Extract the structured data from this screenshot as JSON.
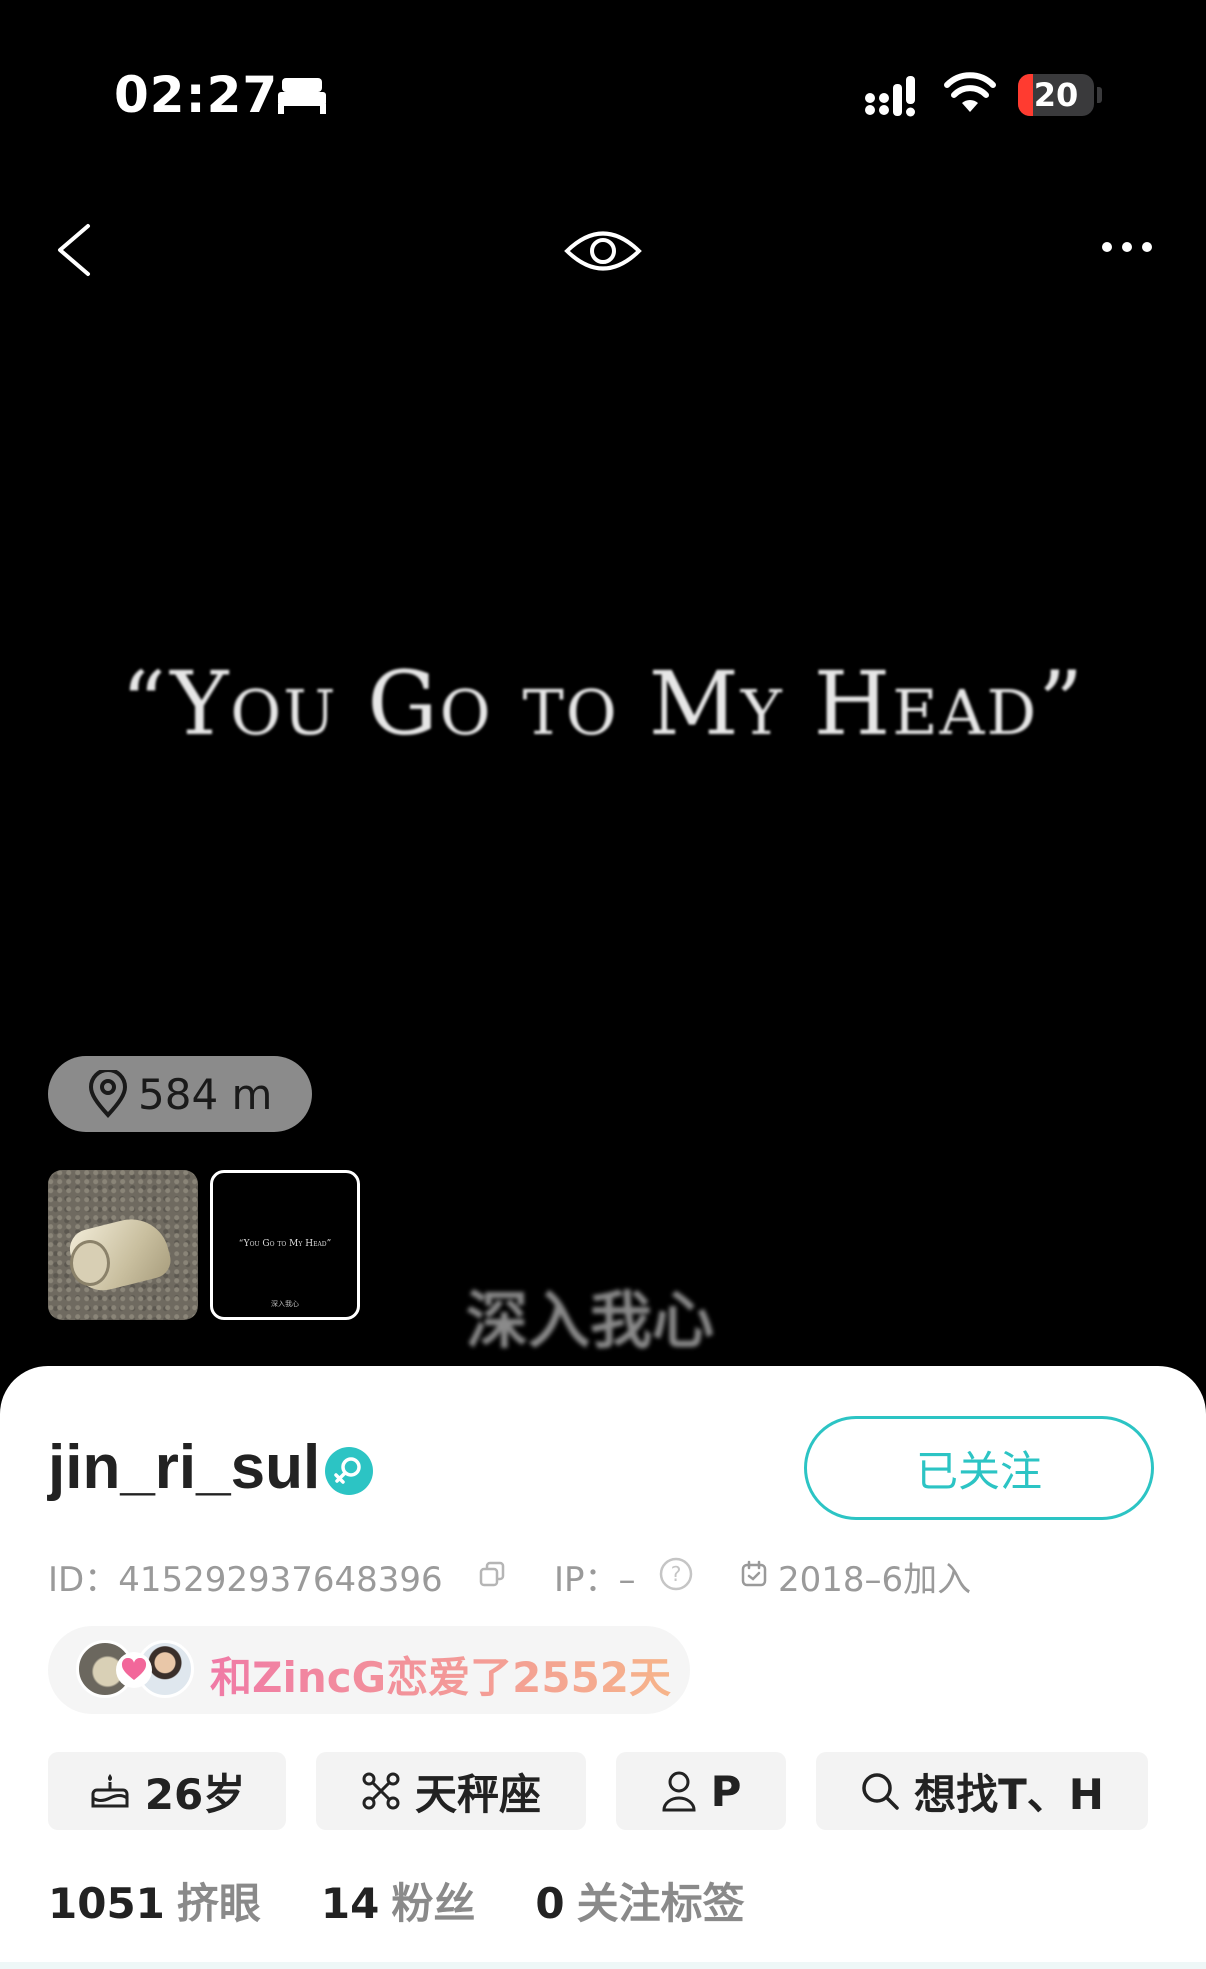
{
  "status_bar": {
    "time": "02:27",
    "battery": "20",
    "battery_level": 0.2,
    "battery_color": "#ff3b30",
    "icons": [
      "bed-icon",
      "signal-icon",
      "wifi-icon",
      "battery-icon"
    ]
  },
  "nav": {
    "icons": [
      "back-icon",
      "eye-icon",
      "more-icon"
    ]
  },
  "hero": {
    "caption": "“You Go to My Head”",
    "subtitle": "深入我心",
    "distance": "584 m",
    "thumb_2_caption": "“You Go to My Head”",
    "thumb_2_subtitle": "深入我心"
  },
  "profile": {
    "username": "jin_ri_sul",
    "follow_label": "已关注",
    "id_label": "ID：415292937648396",
    "ip_label": "IP：–",
    "join_label": "2018–6加入",
    "love_text": "和ZincG恋爱了2552天",
    "accent_color": "#2cc4c4"
  },
  "tags": {
    "age": "26岁",
    "zodiac": "天秤座",
    "role": "P",
    "seeking": "想找T、H"
  },
  "stats": {
    "likes_num": "1051",
    "likes_label": "挤眼",
    "fans_num": "14",
    "fans_label": "粉丝",
    "tags_num": "0",
    "tags_label": "关注标签"
  }
}
